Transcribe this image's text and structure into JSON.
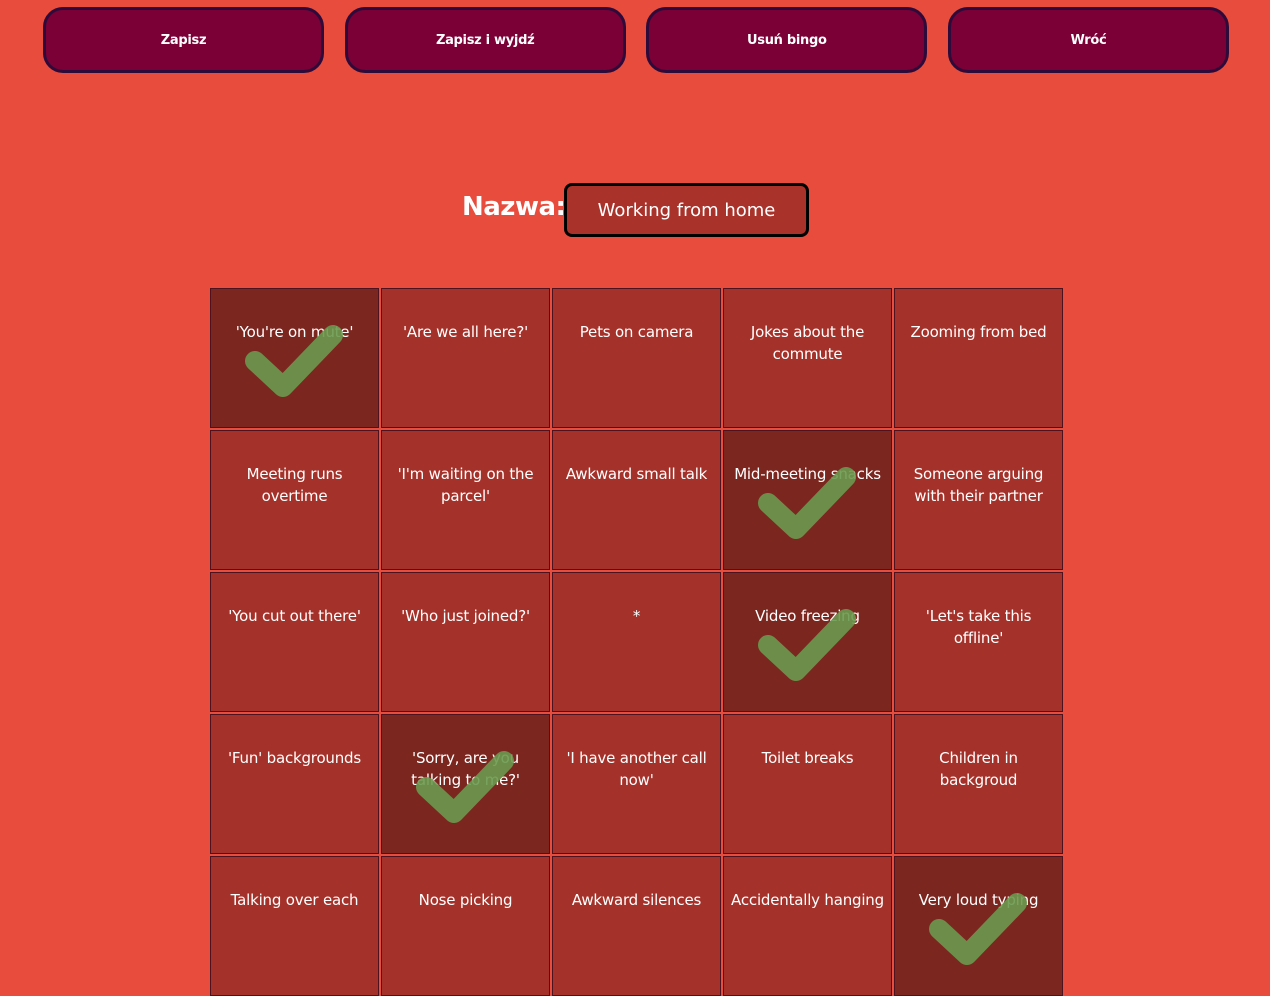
{
  "toolbar": {
    "save_label": "Zapisz",
    "save_exit_label": "Zapisz i wyjdź",
    "delete_label": "Usuń bingo",
    "back_label": "Wróć"
  },
  "name_field": {
    "label": "Nazwa:",
    "value": "Working from home"
  },
  "colors": {
    "background": "#e84c3d",
    "button": "#7a0035",
    "cell": "#a4322a",
    "cell_marked": "#7b261f",
    "check": "#6a9a4f"
  },
  "check_icon": "check-mark-icon",
  "cells": [
    {
      "text": "'You're on mute'",
      "marked": true
    },
    {
      "text": "'Are we all here?'",
      "marked": false
    },
    {
      "text": "Pets on camera",
      "marked": false
    },
    {
      "text": "Jokes about the commute",
      "marked": false
    },
    {
      "text": "Zooming from bed",
      "marked": false
    },
    {
      "text": "Meeting runs overtime",
      "marked": false
    },
    {
      "text": "'I'm waiting on the parcel'",
      "marked": false
    },
    {
      "text": "Awkward small talk",
      "marked": false
    },
    {
      "text": "Mid-meeting snacks",
      "marked": true
    },
    {
      "text": "Someone arguing with their partner",
      "marked": false
    },
    {
      "text": "'You cut out there'",
      "marked": false
    },
    {
      "text": "'Who just joined?'",
      "marked": false
    },
    {
      "text": "*",
      "marked": false
    },
    {
      "text": "Video freezing",
      "marked": true
    },
    {
      "text": "'Let's take this offline'",
      "marked": false
    },
    {
      "text": "'Fun' backgrounds",
      "marked": false
    },
    {
      "text": "'Sorry, are you talking to me?'",
      "marked": true
    },
    {
      "text": "'I have another call now'",
      "marked": false
    },
    {
      "text": "Toilet breaks",
      "marked": false
    },
    {
      "text": "Children in backgroud",
      "marked": false
    },
    {
      "text": "Talking over each",
      "marked": false
    },
    {
      "text": "Nose picking",
      "marked": false
    },
    {
      "text": "Awkward silences",
      "marked": false
    },
    {
      "text": "Accidentally hanging",
      "marked": false
    },
    {
      "text": "Very loud typing",
      "marked": true
    }
  ]
}
